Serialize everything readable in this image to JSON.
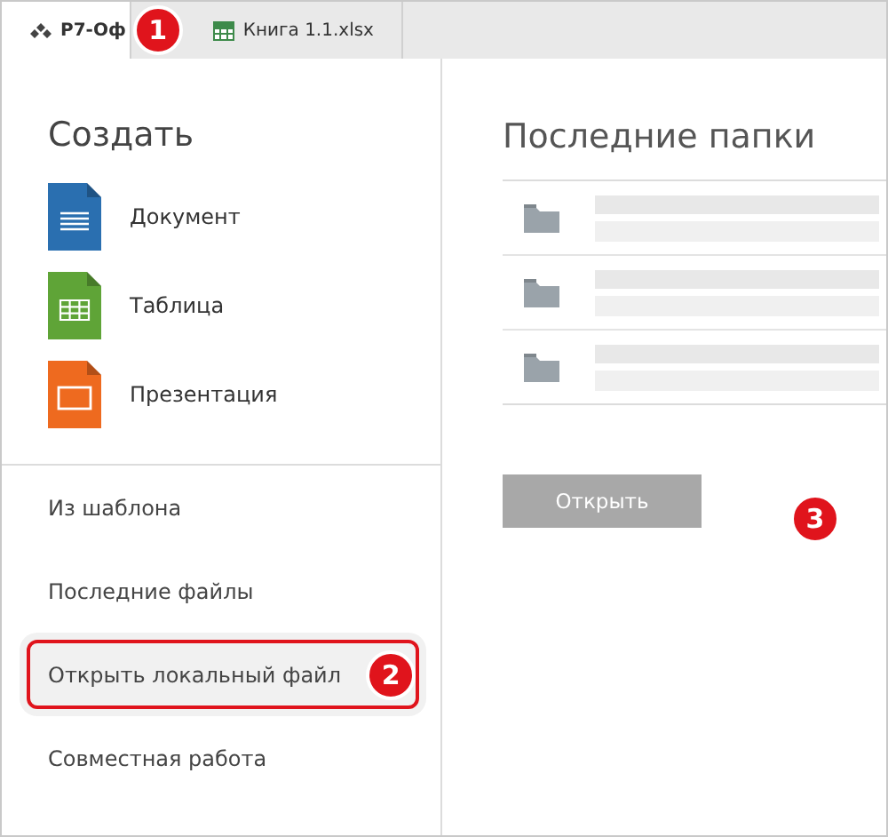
{
  "tabs": [
    {
      "label": "Р7-Оф",
      "kind": "app",
      "selected": true
    },
    {
      "label": "Книга 1.1.xlsx",
      "kind": "spreadsheet",
      "selected": false
    }
  ],
  "sidebar": {
    "create_title": "Создать",
    "create_items": [
      {
        "label": "Документ",
        "kind": "document"
      },
      {
        "label": "Таблица",
        "kind": "spreadsheet"
      },
      {
        "label": "Презентация",
        "kind": "presentation"
      }
    ],
    "items": [
      {
        "label": "Из шаблона",
        "selected": false
      },
      {
        "label": "Последние файлы",
        "selected": false
      },
      {
        "label": "Открыть локальный файл",
        "selected": true,
        "callout": "2"
      },
      {
        "label": "Совместная работа",
        "selected": false
      }
    ]
  },
  "main": {
    "title": "Последние папки",
    "folders": [
      {
        "kind": "folder"
      },
      {
        "kind": "folder"
      },
      {
        "kind": "folder"
      }
    ],
    "open_button": {
      "label": "Открыть",
      "disabled": true
    }
  },
  "callouts": {
    "tab": "1",
    "main": "3"
  }
}
